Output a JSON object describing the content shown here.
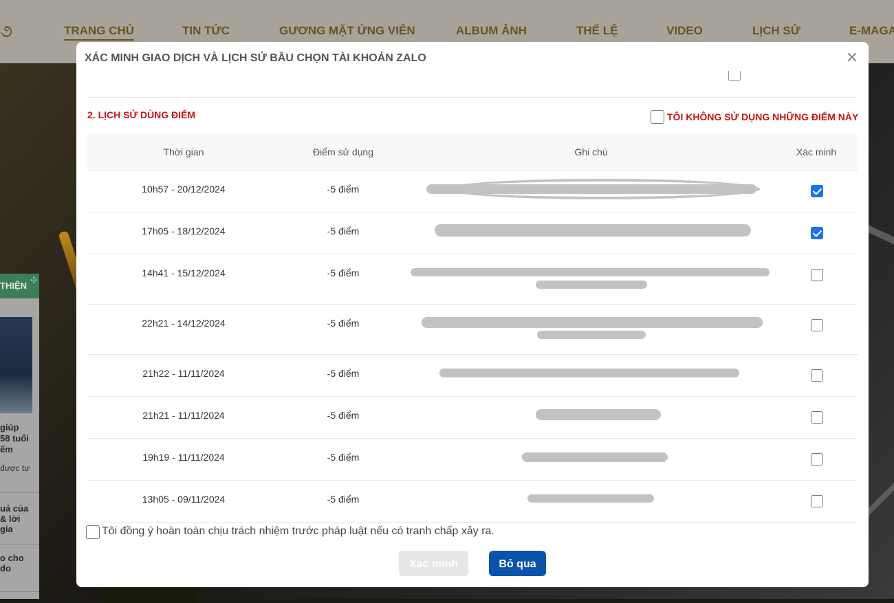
{
  "site": {
    "nav": [
      {
        "label": "TRANG CHỦ",
        "active": true
      },
      {
        "label": "TIN TỨC",
        "active": false
      },
      {
        "label": "GƯƠNG MẶT ỨNG VIÊN",
        "active": false
      },
      {
        "label": "ALBUM ẢNH",
        "active": false
      },
      {
        "label": "THỂ LỆ",
        "active": false
      },
      {
        "label": "VIDEO",
        "active": false
      },
      {
        "label": "LỊCH SỬ",
        "active": false
      },
      {
        "label": "E-MAGA",
        "active": false
      }
    ],
    "side_panel": {
      "header": "THIỆN",
      "texts": [
        "giúp",
        "58 tuổi",
        "ếm",
        "được tự",
        "uả của",
        "& lời",
        "gia",
        "o cho",
        "do"
      ]
    },
    "colors": {
      "nav_text": "#6b5422",
      "side_header": "#3e7d5a"
    }
  },
  "modal": {
    "title": "XÁC MINH GIAO DỊCH VÀ LỊCH SỬ BẦU CHỌN TÀI KHOẢN ZALO",
    "close_icon": "close-icon",
    "section_title": "2. LỊCH SỬ DÙNG ĐIỂM",
    "optout_label": "TÔI KHÔNG SỬ DỤNG NHỮNG ĐIỂM NÀY",
    "columns": [
      "Thời gian",
      "Điểm sử dụng",
      "Ghi chú",
      "Xác minh"
    ],
    "rows": [
      {
        "time": "10h57 - 20/12/2024",
        "points": "-5 điểm",
        "verified": true
      },
      {
        "time": "17h05 - 18/12/2024",
        "points": "-5 điểm",
        "verified": true
      },
      {
        "time": "14h41 - 15/12/2024",
        "points": "-5 điểm",
        "verified": false
      },
      {
        "time": "22h21 - 14/12/2024",
        "points": "-5 điểm",
        "verified": false
      },
      {
        "time": "21h22 - 11/11/2024",
        "points": "-5 điểm",
        "verified": false
      },
      {
        "time": "21h21 - 11/11/2024",
        "points": "-5 điểm",
        "verified": false
      },
      {
        "time": "19h19 - 11/11/2024",
        "points": "-5 điểm",
        "verified": false
      },
      {
        "time": "13h05 - 09/11/2024",
        "points": "-5 điểm",
        "verified": false
      }
    ],
    "agree_label": "Tôi đồng ý hoàn toàn chịu trách nhiệm trước pháp luật nếu có tranh chấp xảy ra.",
    "buttons": {
      "verify": "Xác minh",
      "skip": "Bỏ qua"
    },
    "colors": {
      "accent_red": "#c81414",
      "checkbox_blue": "#1a73e8",
      "primary_button": "#0b53a8",
      "disabled_button": "#e6e6e6"
    }
  }
}
